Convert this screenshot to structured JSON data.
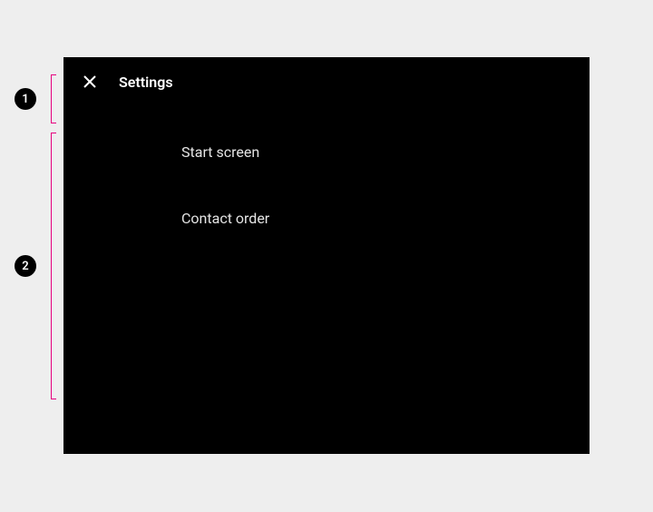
{
  "header": {
    "title": "Settings"
  },
  "menu": {
    "items": [
      {
        "label": "Start screen"
      },
      {
        "label": "Contact order"
      }
    ]
  },
  "annotations": {
    "badge1": "1",
    "badge2": "2"
  }
}
